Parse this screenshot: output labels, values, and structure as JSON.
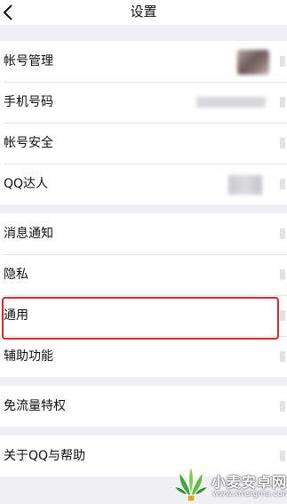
{
  "header": {
    "title": "设置"
  },
  "groups": [
    {
      "rows": [
        {
          "label": "帐号管理"
        },
        {
          "label": "手机号码"
        },
        {
          "label": "帐号安全"
        },
        {
          "label": "QQ达人"
        }
      ]
    },
    {
      "rows": [
        {
          "label": "消息通知"
        },
        {
          "label": "隐私"
        },
        {
          "label": "通用"
        },
        {
          "label": "辅助功能"
        }
      ]
    },
    {
      "rows": [
        {
          "label": "免流量特权"
        }
      ]
    },
    {
      "rows": [
        {
          "label": "关于QQ与帮助"
        }
      ]
    }
  ],
  "watermark": {
    "title": "小麦安卓网",
    "url": "www.xmsigma.com"
  },
  "colors": {
    "background": "#efeff4",
    "highlight": "#e2262b",
    "logo_green": "#3fa63c"
  },
  "icons": [
    "back-arrow-icon"
  ]
}
